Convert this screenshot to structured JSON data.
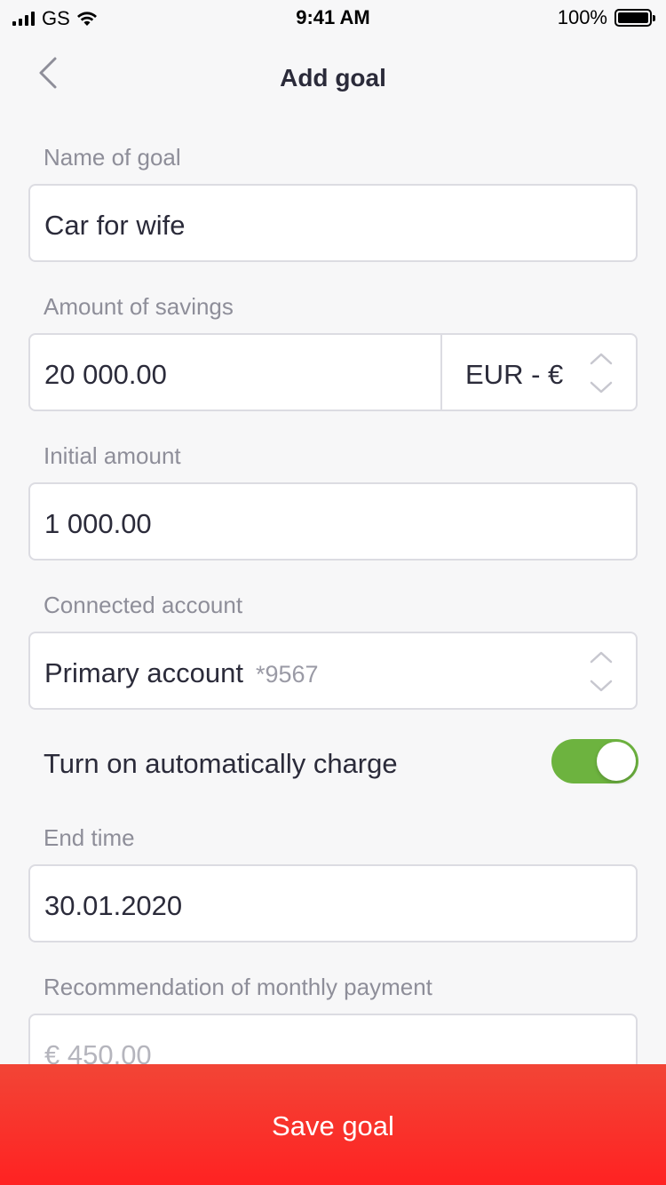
{
  "status": {
    "carrier": "GS",
    "time": "9:41 AM",
    "battery": "100%"
  },
  "nav": {
    "title": "Add goal"
  },
  "form": {
    "name_label": "Name of goal",
    "name_value": "Car for wife",
    "amount_label": "Amount of savings",
    "amount_value": "20 000.00",
    "currency_value": "EUR - €",
    "initial_label": "Initial amount",
    "initial_value": "1 000.00",
    "account_label": "Connected account",
    "account_name": "Primary account",
    "account_number": "*9567",
    "auto_charge_label": "Turn on automatically charge",
    "auto_charge_on": true,
    "end_label": "End time",
    "end_value": "30.01.2020",
    "recommend_label": "Recommendation of monthly payment",
    "recommend_value": "€ 450.00"
  },
  "actions": {
    "save_label": "Save goal"
  },
  "colors": {
    "accent_red": "#f53a2e",
    "toggle_green": "#6db33f"
  }
}
